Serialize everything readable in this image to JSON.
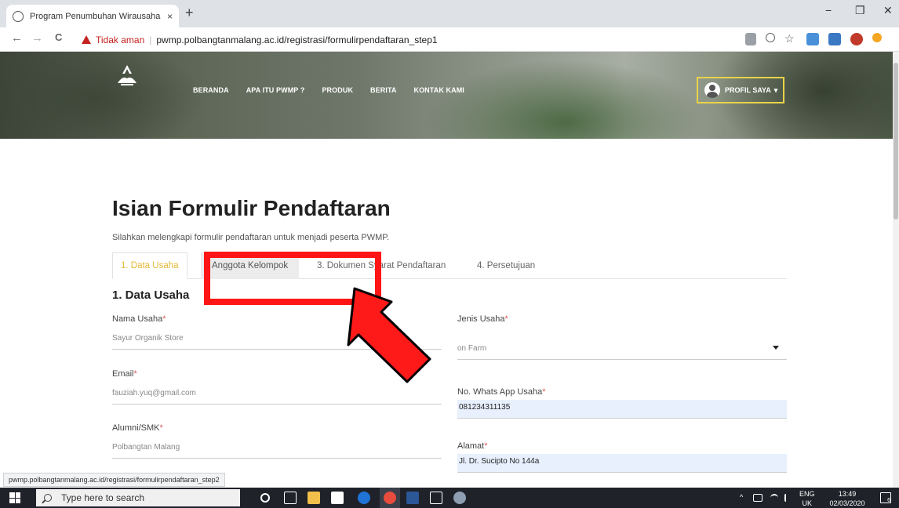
{
  "browser": {
    "tab_title": "Program Penumbuhan Wirausaha",
    "tab_close": "×",
    "new_tab": "+",
    "window": {
      "minimize": "−",
      "restore": "❐",
      "close": "✕"
    },
    "nav": {
      "back": "←",
      "forward": "→",
      "reload": "C"
    },
    "security_label": "Tidak aman",
    "separator": "|",
    "url": "pwmp.polbangtanmalang.ac.id/registrasi/formulirpendaftaran_step1",
    "status_url": "pwmp.polbangtanmalang.ac.id/registrasi/formulirpendaftaran_step2"
  },
  "site": {
    "nav_items": [
      "BERANDA",
      "APA ITU PWMP ?",
      "PRODUK",
      "BERITA",
      "KONTAK KAMI"
    ],
    "profile_label": "PROFIL SAYA"
  },
  "form": {
    "title": "Isian Formulir Pendaftaran",
    "subtitle": "Silahkan melengkapi formulir pendaftaran untuk menjadi peserta PWMP.",
    "tabs": [
      "1. Data Usaha",
      "Anggota Kelompok",
      "3. Dokumen Syarat Pendaftaran",
      "4. Persetujuan"
    ],
    "section_title": "1. Data Usaha",
    "required_mark": "*",
    "fields": {
      "nama_usaha": {
        "label": "Nama Usaha",
        "value": "Sayur Organik Store"
      },
      "email": {
        "label": "Email",
        "value": "fauziah.yuq@gmail.com"
      },
      "alumni": {
        "label": "Alumni/SMK",
        "value": "Polbangtan Malang"
      },
      "jenis_usaha": {
        "label": "Jenis Usaha",
        "value": "on Farm"
      },
      "whatsapp": {
        "label": "No. Whats App Usaha",
        "value": "081234311135"
      },
      "alamat": {
        "label": "Alamat",
        "value": "Jl. Dr. Sucipto No 144a"
      }
    }
  },
  "taskbar": {
    "search_placeholder": "Type here to search",
    "lang_top": "ENG",
    "lang_bottom": "UK",
    "time": "13:49",
    "date": "02/03/2020",
    "notif_count": "6"
  },
  "colors": {
    "accent_yellow": "#e4b938",
    "annotation_red": "#ff1515",
    "insecure_red": "#c5221f",
    "autofill_blue": "#e8f0fe"
  }
}
